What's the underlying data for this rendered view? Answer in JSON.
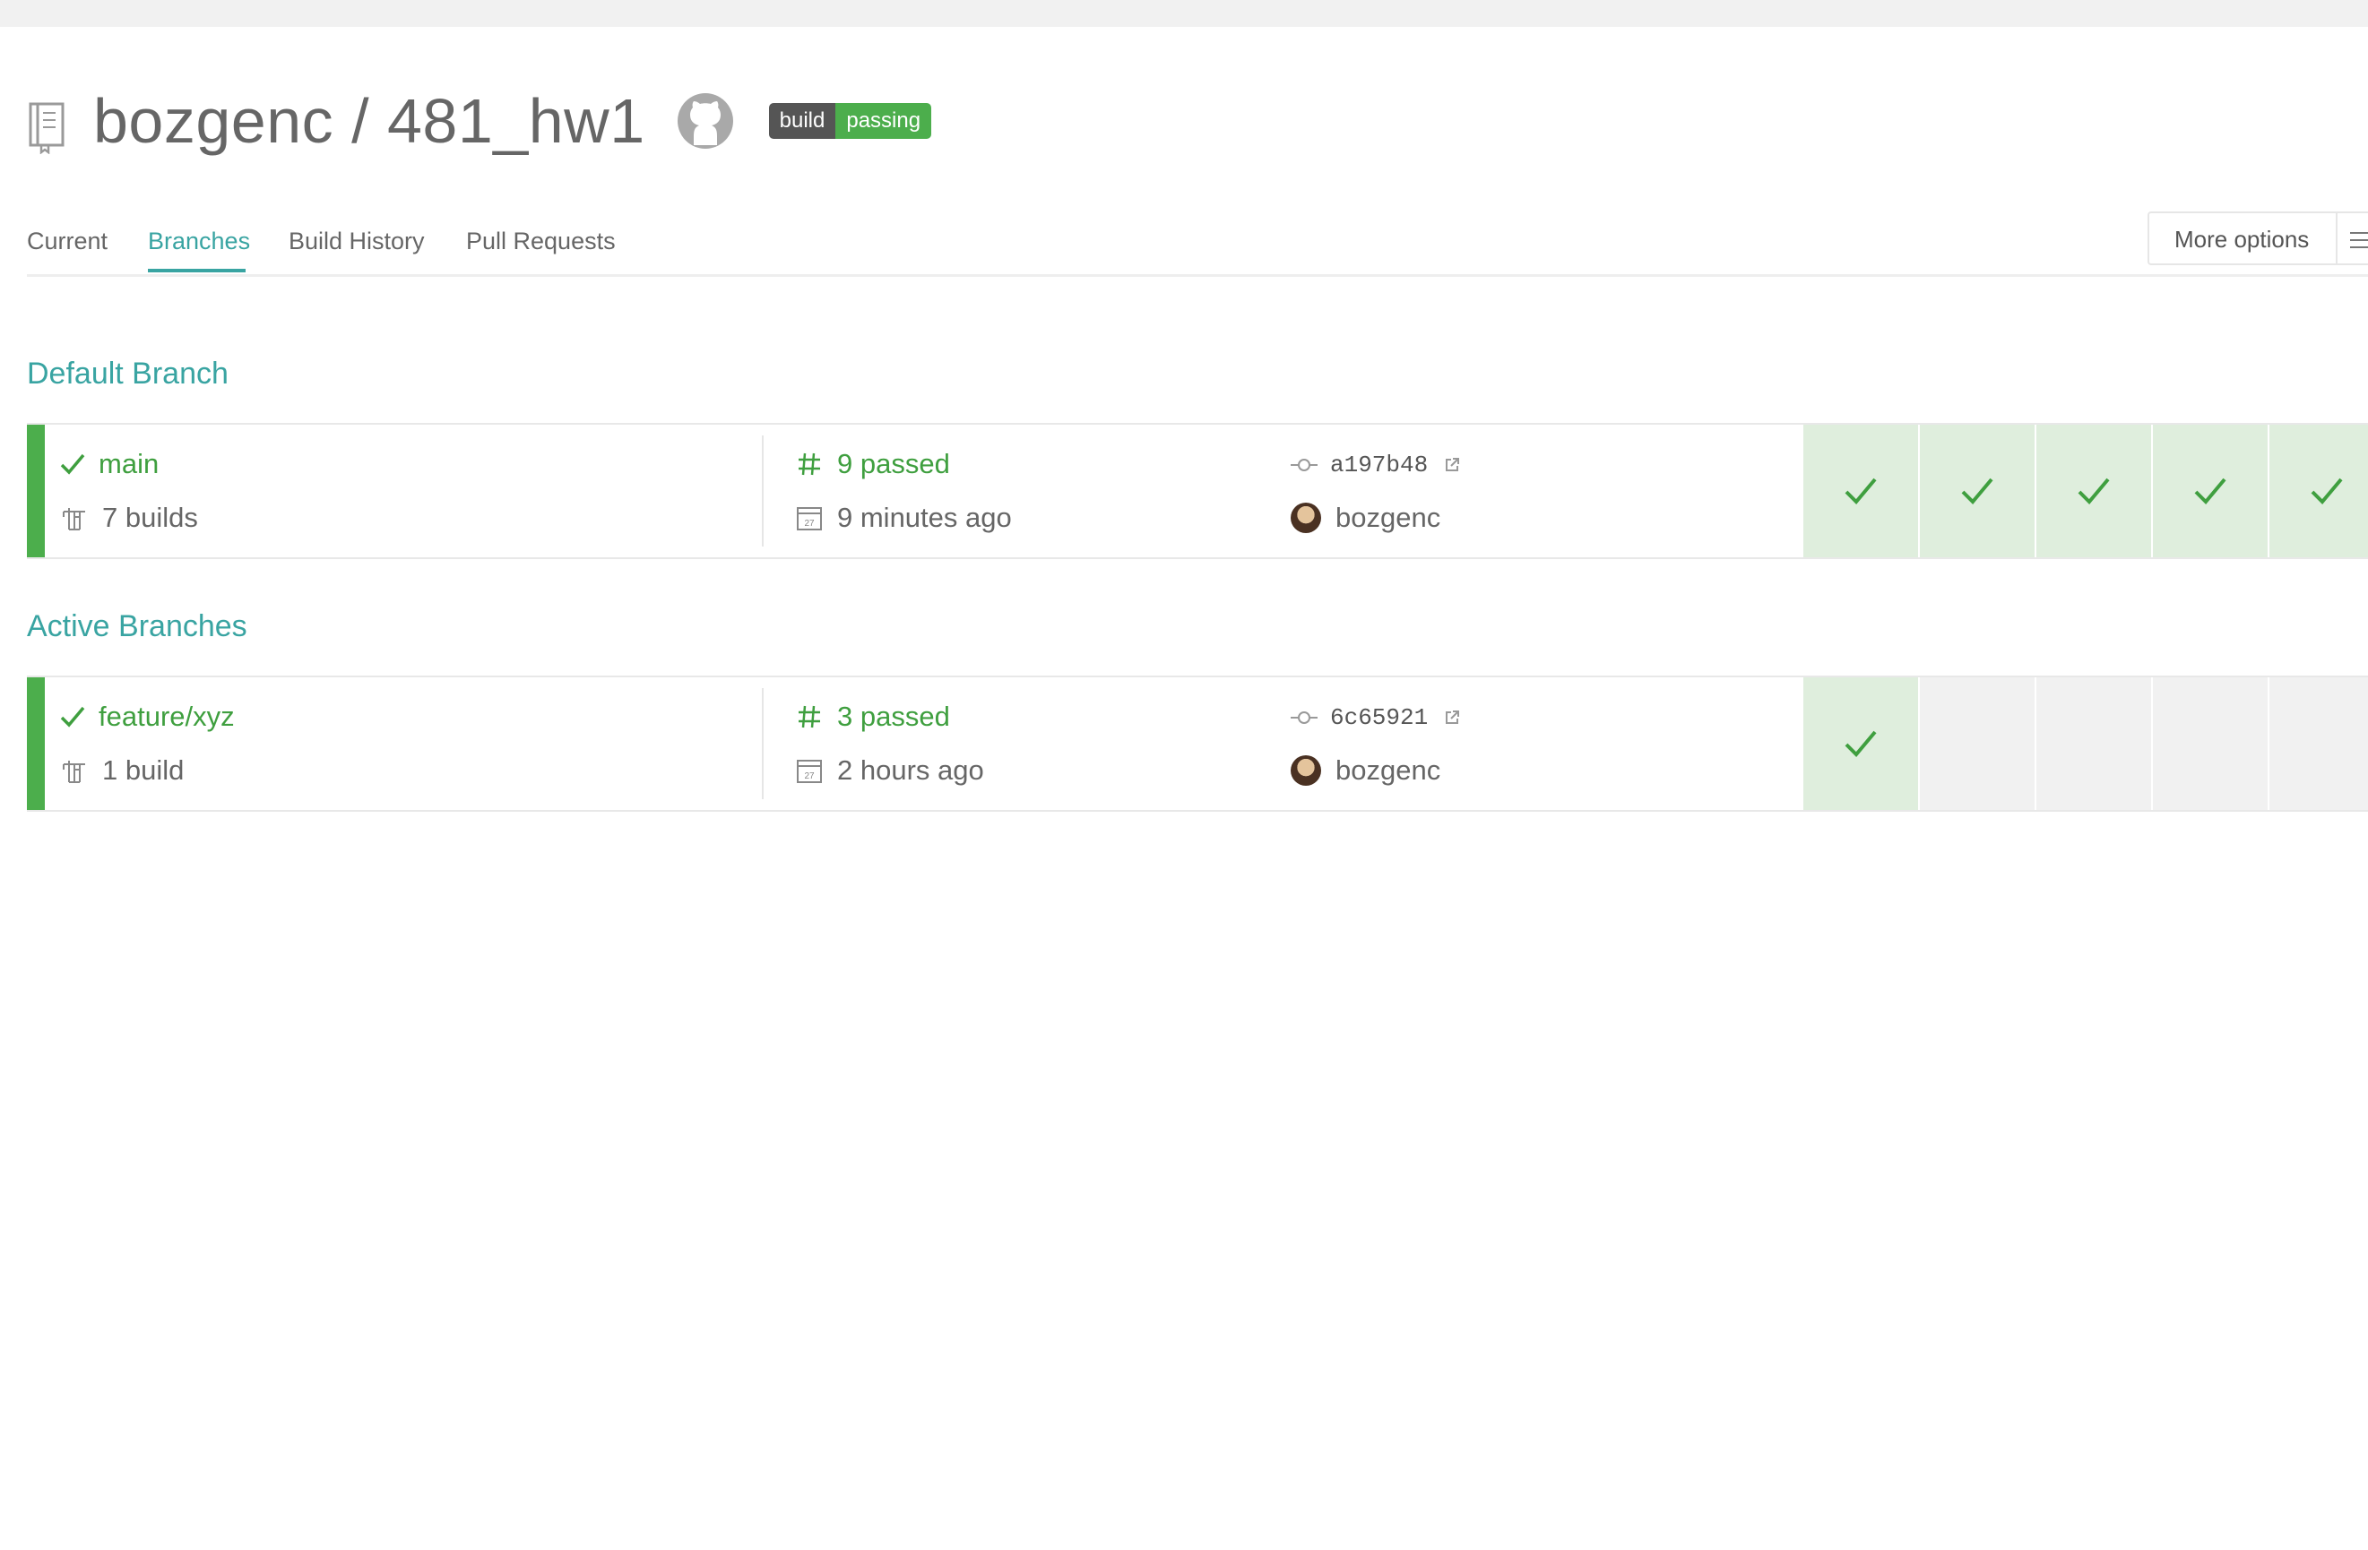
{
  "repo": {
    "title": "bozgenc / 481_hw1",
    "badge_left": "build",
    "badge_right": "passing"
  },
  "tabs": [
    {
      "label": "Current",
      "active": false
    },
    {
      "label": "Branches",
      "active": true
    },
    {
      "label": "Build History",
      "active": false
    },
    {
      "label": "Pull Requests",
      "active": false
    }
  ],
  "more_options": {
    "label": "More options"
  },
  "sections": {
    "default_title": "Default Branch",
    "active_title": "Active Branches"
  },
  "default_branch": {
    "name": "main",
    "builds": "7 builds",
    "status": "9 passed",
    "time": "9 minutes ago",
    "commit": "a197b48",
    "author": "bozgenc",
    "history": [
      "passed",
      "passed",
      "passed",
      "passed",
      "passed"
    ]
  },
  "active_branches": [
    {
      "name": "feature/xyz",
      "builds": "1 build",
      "status": "3 passed",
      "time": "2 hours ago",
      "commit": "6c65921",
      "author": "bozgenc",
      "history": [
        "passed",
        "empty",
        "empty",
        "empty",
        "empty"
      ]
    }
  ],
  "colors": {
    "accent": "#39a4a2",
    "passed": "#3f9f3f",
    "passed_tile": "#dfeedd",
    "empty_tile": "#f1f1f1",
    "text": "#666666"
  }
}
